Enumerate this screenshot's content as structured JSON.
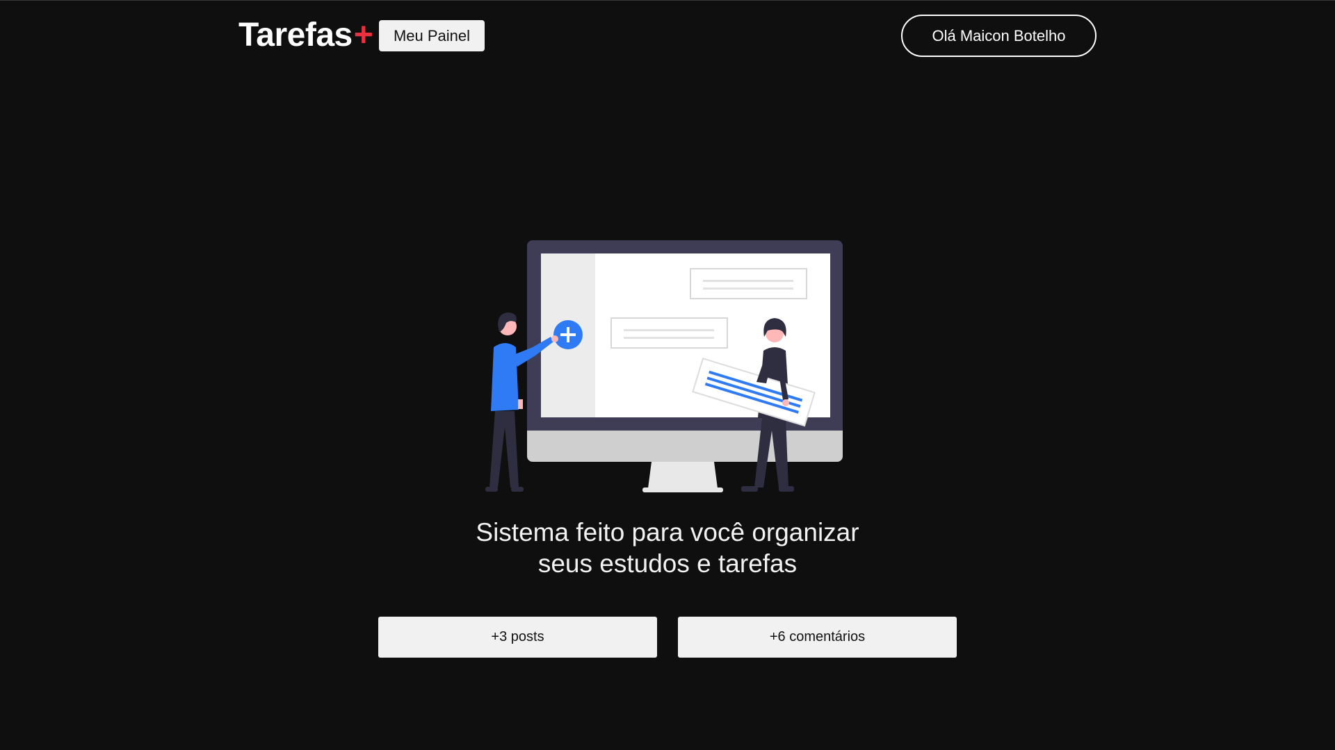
{
  "header": {
    "logo_text": "Tarefas",
    "logo_plus": "+",
    "panel_button": "Meu Painel",
    "user_button": "Olá Maicon Botelho"
  },
  "hero": {
    "illustration": "people-organizing-tasks-on-monitor",
    "headline_line1": "Sistema feito para você organizar",
    "headline_line2": "seus estudos e tarefas"
  },
  "stats": {
    "posts_label": "+3 posts",
    "comments_label": "+6 comentários"
  },
  "colors": {
    "background": "#0f0f0f",
    "accent": "#ea3140",
    "button_bg": "#f1f1f1",
    "illustration_blue": "#2f7bf5",
    "illustration_dark": "#3f3d56"
  }
}
